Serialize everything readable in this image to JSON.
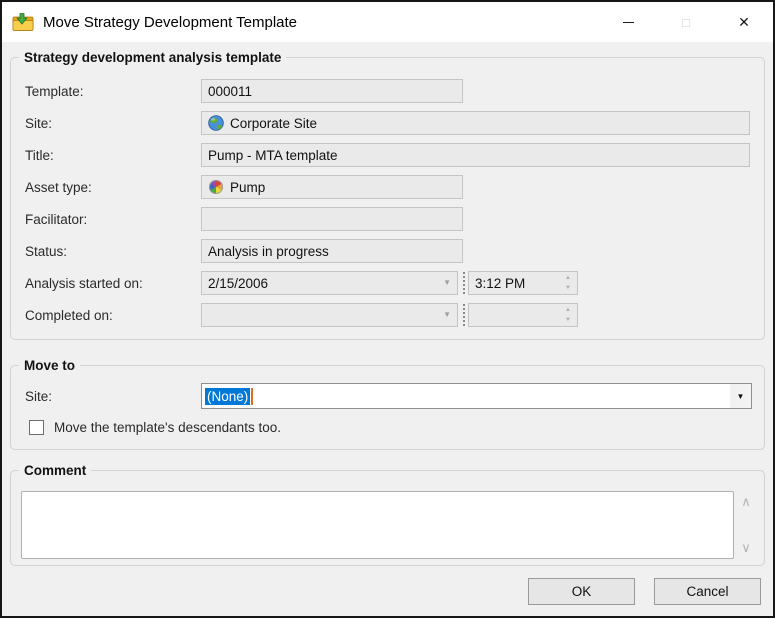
{
  "window": {
    "title": "Move Strategy Development Template",
    "maximize_glyph": "□",
    "close_glyph": "✕"
  },
  "template_section": {
    "title": "Strategy development analysis template",
    "template_label": "Template:",
    "template_value": "000011",
    "site_label": "Site:",
    "site_value": "Corporate Site",
    "site_icon": "globe-icon",
    "title_label": "Title:",
    "title_value": "Pump - MTA template",
    "asset_type_label": "Asset type:",
    "asset_type_value": "Pump",
    "asset_type_icon": "asset-cube-icon",
    "facilitator_label": "Facilitator:",
    "facilitator_value": "",
    "status_label": "Status:",
    "status_value": "Analysis in progress",
    "analysis_started_label": "Analysis started on:",
    "analysis_started_date": "2/15/2006",
    "analysis_started_time": "3:12 PM",
    "completed_label": "Completed on:",
    "completed_date": "",
    "completed_time": ""
  },
  "move_section": {
    "title": "Move to",
    "site_label": "Site:",
    "site_selected": "(None)",
    "descendants_label": "Move the template's descendants too.",
    "descendants_checked": false
  },
  "comment_section": {
    "title": "Comment",
    "value": ""
  },
  "actions": {
    "ok": "OK",
    "cancel": "Cancel"
  },
  "icons": {
    "dropdown_arrow": "▼",
    "spin_up": "▲",
    "spin_down": "▼",
    "scroll_up": "∧",
    "scroll_down": "∨"
  },
  "colors": {
    "selection_bg": "#0078d7",
    "selection_text": "#ffffff",
    "dialog_bg": "#f0f0f0",
    "titlebar_bg": "#ffffff",
    "caret": "#e06c1f"
  }
}
